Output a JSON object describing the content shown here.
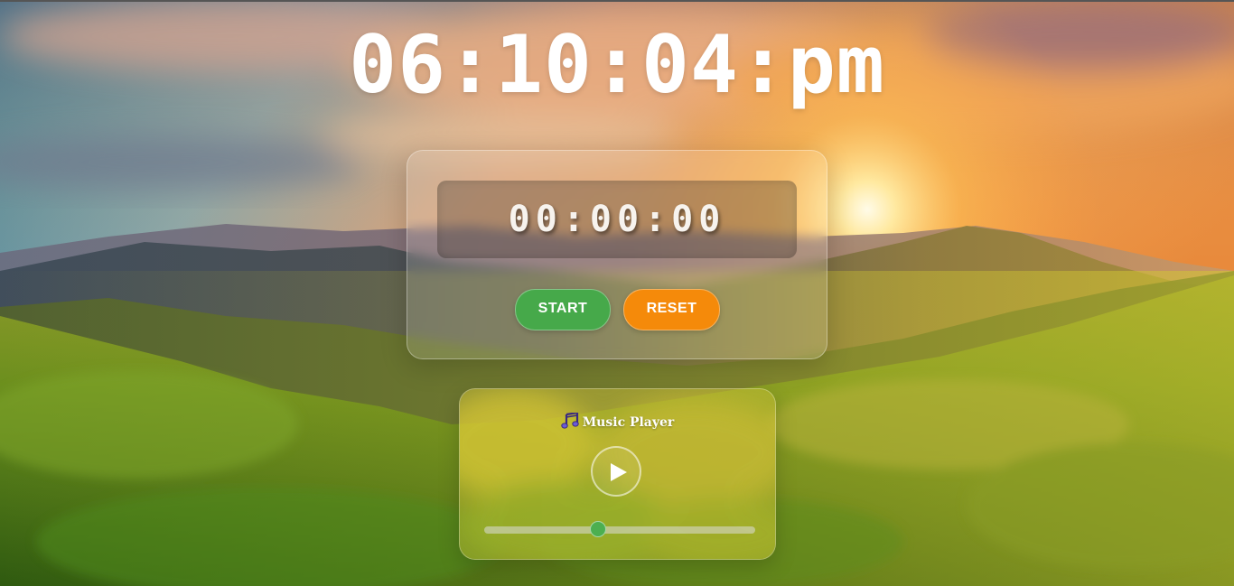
{
  "clock": {
    "time": "06:10:04:pm"
  },
  "stopwatch": {
    "display": "00:00:00",
    "start_label": "START",
    "reset_label": "RESET"
  },
  "music_player": {
    "title": "Music Player",
    "progress": 0.42
  },
  "colors": {
    "start_button": "#46a94a",
    "reset_button": "#f58a0a",
    "slider_thumb": "#4caf50",
    "text": "#ffffff"
  },
  "icons": {
    "title_icon": "music-note-icon",
    "play_icon": "play-icon"
  }
}
